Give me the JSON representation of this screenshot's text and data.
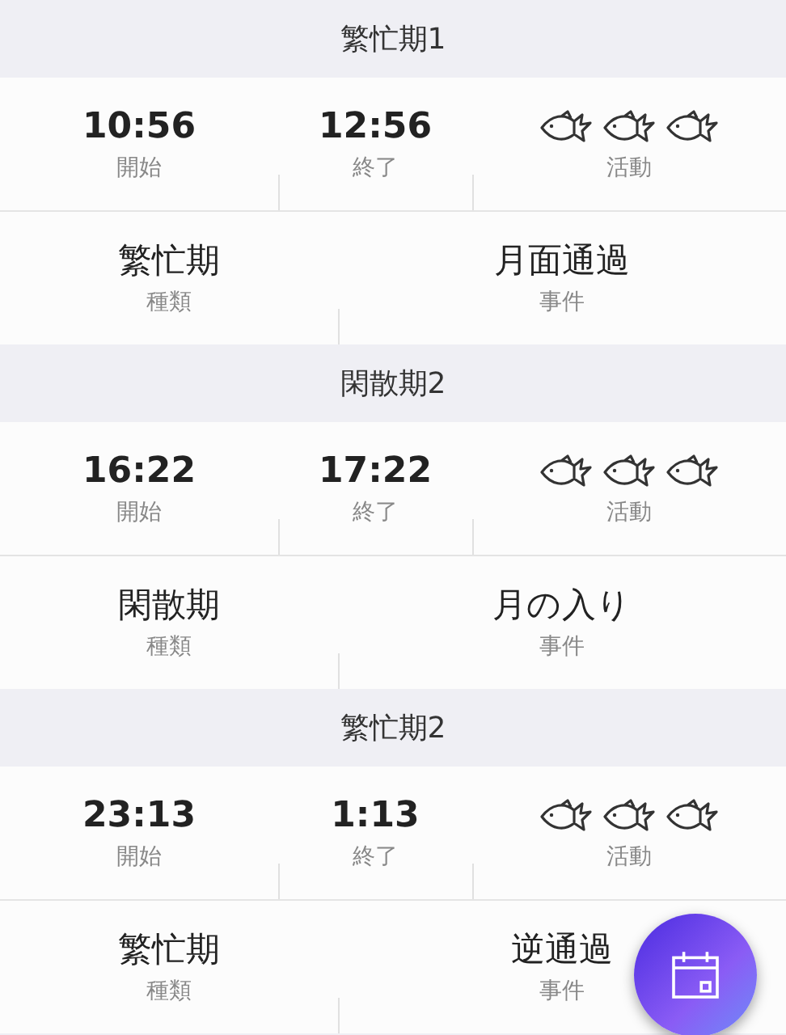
{
  "periods": [
    {
      "title": "繁忙期1",
      "start": "10:56",
      "start_label": "開始",
      "end": "12:56",
      "end_label": "終了",
      "activity_label": "活動",
      "type": "繁忙期",
      "type_label": "種類",
      "event": "月面通過",
      "event_label": "事件"
    },
    {
      "title": "閑散期2",
      "start": "16:22",
      "start_label": "開始",
      "end": "17:22",
      "end_label": "終了",
      "activity_label": "活動",
      "type": "閑散期",
      "type_label": "種類",
      "event": "月の入り",
      "event_label": "事件"
    },
    {
      "title": "繁忙期2",
      "start": "23:13",
      "start_label": "開始",
      "end": "1:13",
      "end_label": "終了",
      "activity_label": "活動",
      "type": "繁忙期",
      "type_label": "種類",
      "event": "逆通過",
      "event_label": "事件"
    }
  ]
}
